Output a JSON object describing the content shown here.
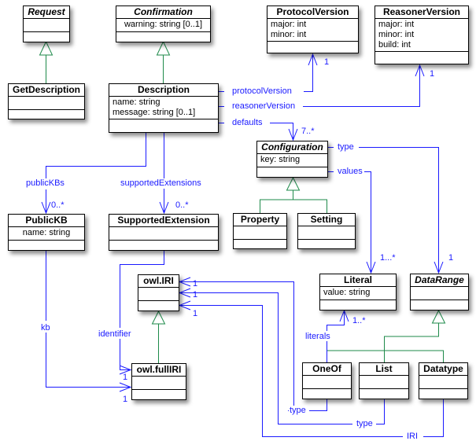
{
  "colors": {
    "association": "#1a1aff",
    "generalization": "#1e8a4a",
    "border": "#000000"
  },
  "classes": {
    "request": {
      "name": "Request",
      "abstract": true,
      "attributes": []
    },
    "confirmation": {
      "name": "Confirmation",
      "abstract": true,
      "attributes": [
        "warning: string [0..1]"
      ]
    },
    "protocol_version": {
      "name": "ProtocolVersion",
      "abstract": false,
      "attributes": [
        "major: int",
        "minor: int"
      ]
    },
    "reasoner_version": {
      "name": "ReasonerVersion",
      "abstract": false,
      "attributes": [
        "major: int",
        "minor: int",
        "build: int"
      ]
    },
    "get_description": {
      "name": "GetDescription",
      "abstract": false,
      "attributes": []
    },
    "description": {
      "name": "Description",
      "abstract": false,
      "attributes": [
        "name: string",
        "message: string [0..1]"
      ]
    },
    "configuration": {
      "name": "Configuration",
      "abstract": true,
      "attributes": [
        "key: string"
      ]
    },
    "public_kb": {
      "name": "PublicKB",
      "abstract": false,
      "attributes": [
        "name: string"
      ]
    },
    "supported_extension": {
      "name": "SupportedExtension",
      "abstract": false,
      "attributes": []
    },
    "property": {
      "name": "Property",
      "abstract": false,
      "attributes": []
    },
    "setting": {
      "name": "Setting",
      "abstract": false,
      "attributes": []
    },
    "owl_iri": {
      "name": "owl.IRI",
      "abstract": false,
      "attributes": []
    },
    "literal": {
      "name": "Literal",
      "abstract": false,
      "attributes": [
        "value: string"
      ]
    },
    "data_range": {
      "name": "DataRange",
      "abstract": true,
      "attributes": []
    },
    "owl_full_iri": {
      "name": "owl.fullIRI",
      "abstract": false,
      "attributes": []
    },
    "one_of": {
      "name": "OneOf",
      "abstract": false,
      "attributes": []
    },
    "list": {
      "name": "List",
      "abstract": false,
      "attributes": []
    },
    "datatype": {
      "name": "Datatype",
      "abstract": false,
      "attributes": []
    }
  },
  "associations": {
    "protocol_version": {
      "role": "protocolVersion",
      "multiplicity": "1"
    },
    "reasoner_version": {
      "role": "reasonerVersion",
      "multiplicity": "1"
    },
    "defaults": {
      "role": "defaults",
      "multiplicity": "7..*"
    },
    "public_kbs": {
      "role": "publicKBs",
      "multiplicity": "0..*"
    },
    "supported_extensions": {
      "role": "supportedExtensions",
      "multiplicity": "0..*"
    },
    "config_type": {
      "role": "type",
      "multiplicity": "1"
    },
    "config_values": {
      "role": "values",
      "multiplicity": "1...*"
    },
    "kb": {
      "role": "kb",
      "multiplicity": "1"
    },
    "identifier": {
      "role": "identifier",
      "multiplicity": "1"
    },
    "literals": {
      "role": "literals",
      "multiplicity": "1..*"
    },
    "oneof_type": {
      "role": "type",
      "multiplicity": "1"
    },
    "list_type": {
      "role": "type",
      "multiplicity": "1"
    },
    "datatype_iri": {
      "role": "IRI",
      "multiplicity": "1"
    }
  }
}
